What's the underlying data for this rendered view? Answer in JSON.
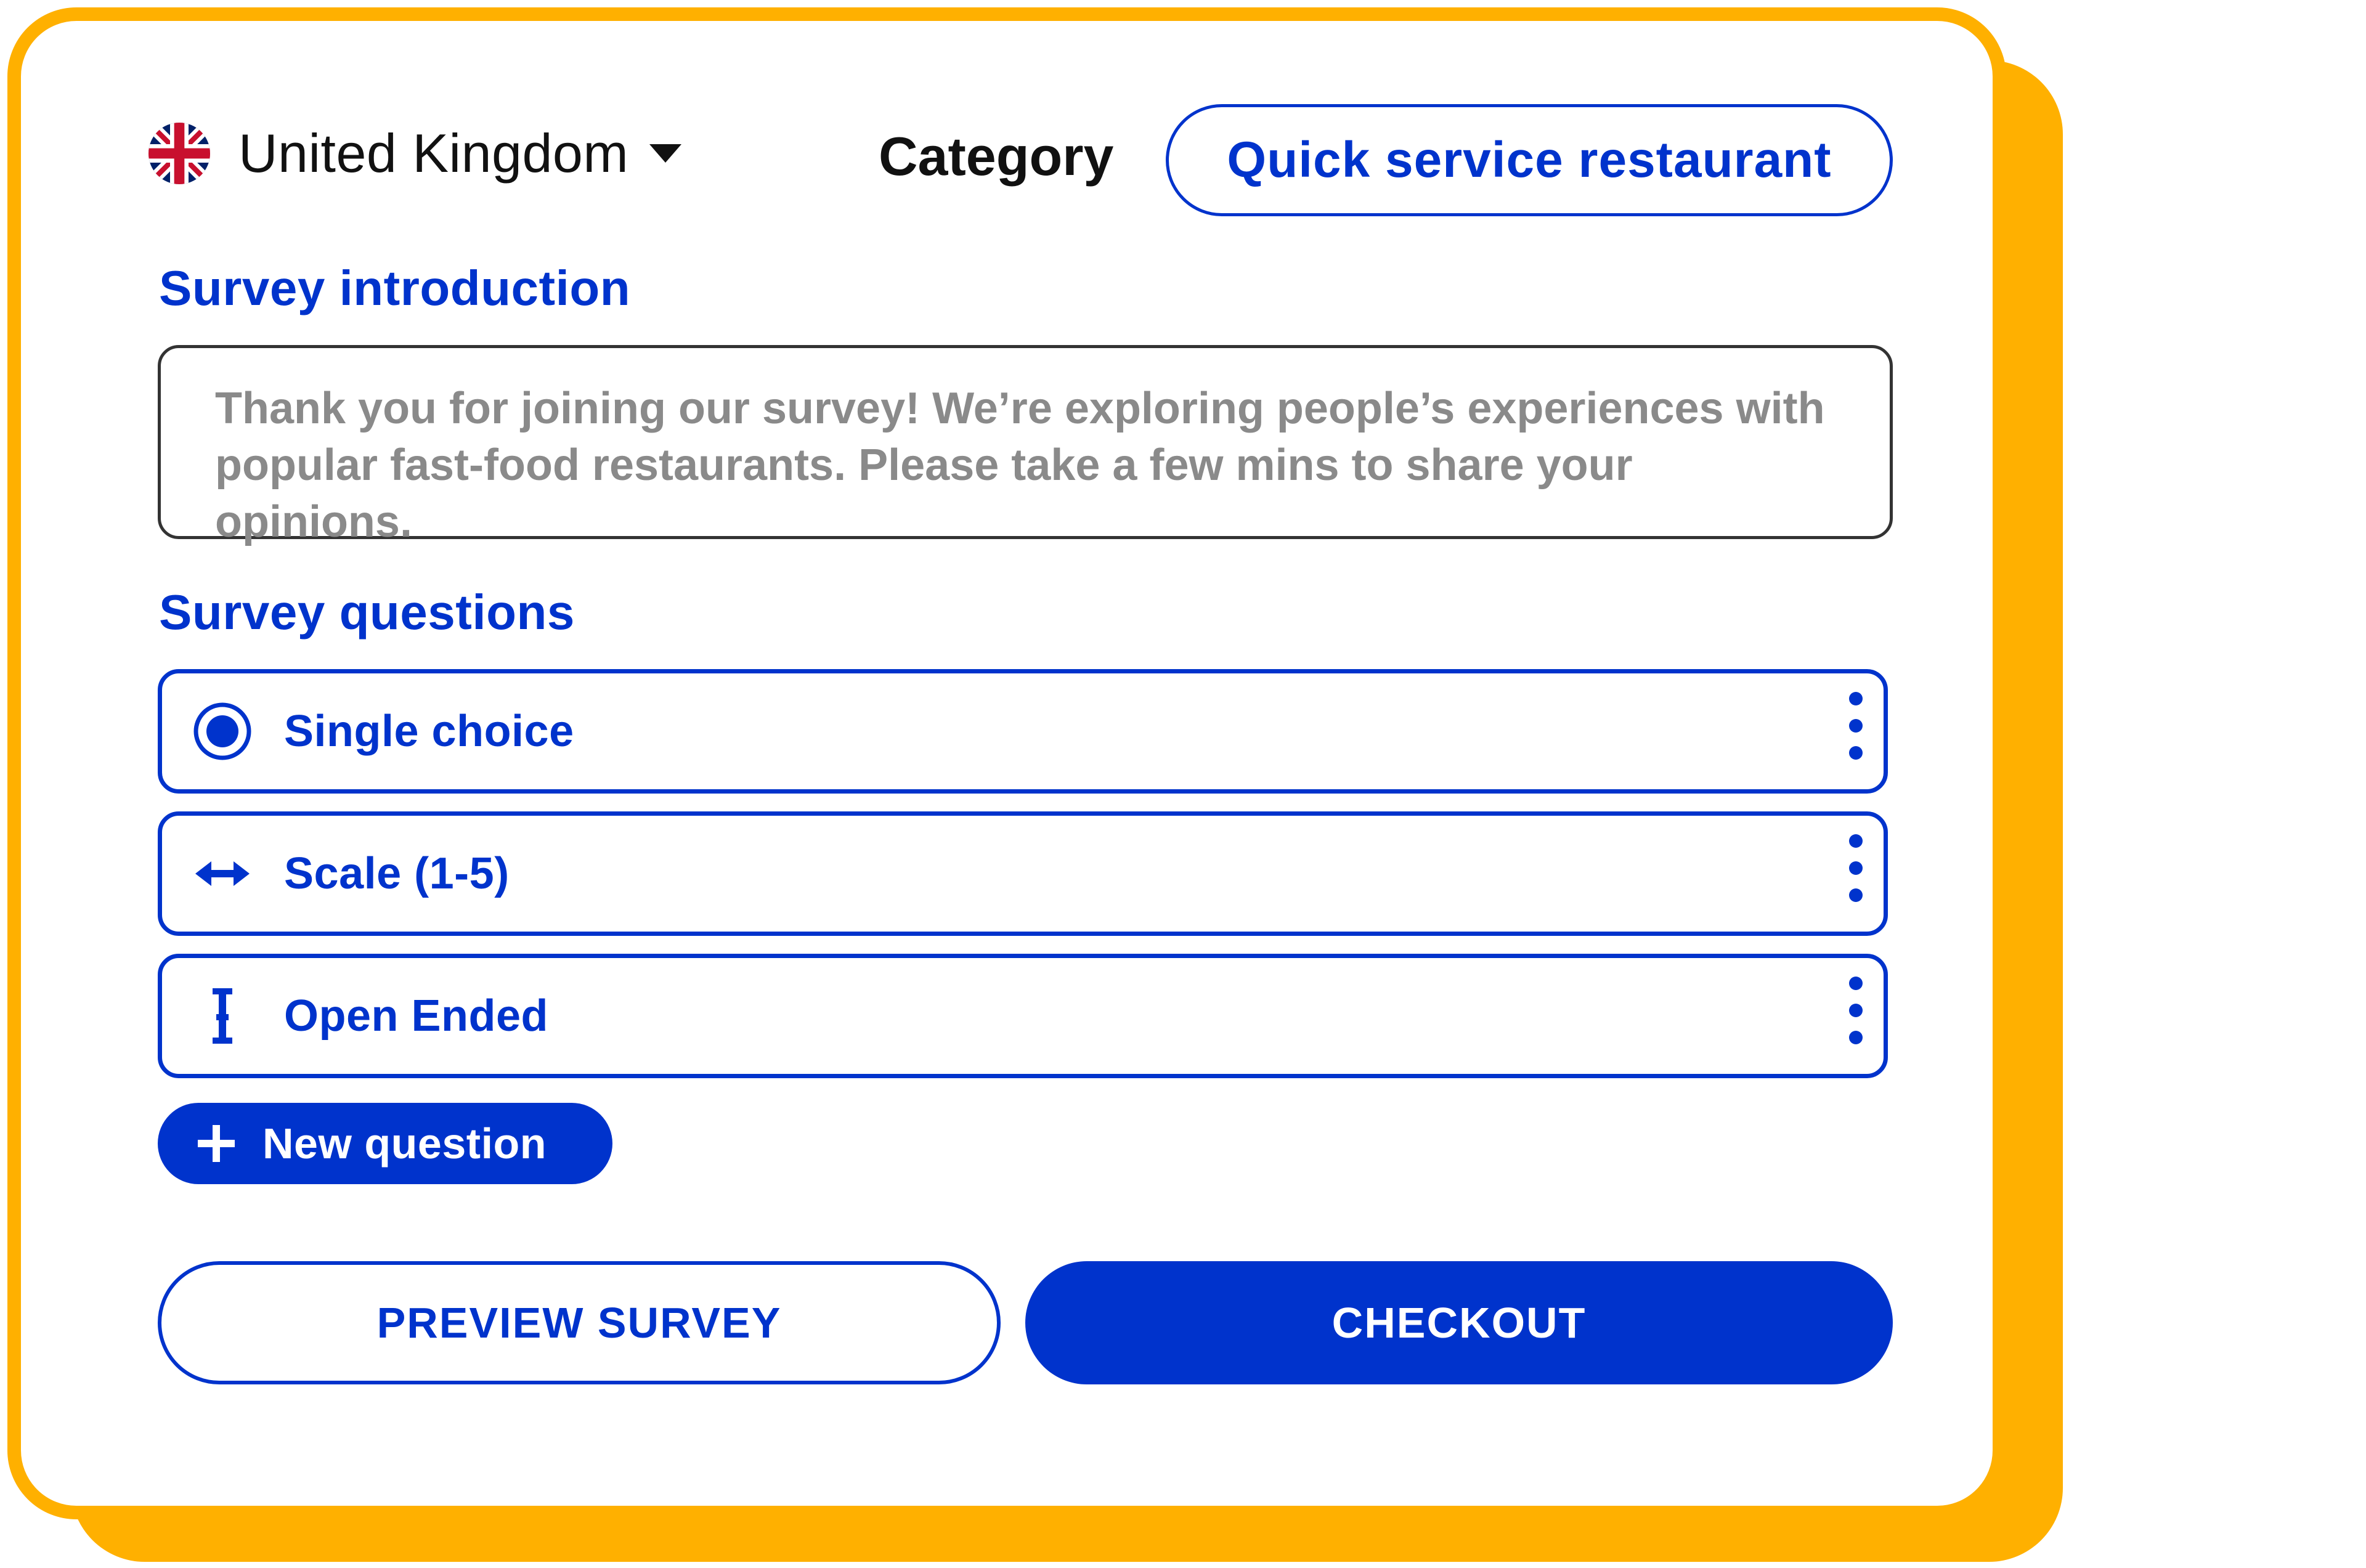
{
  "colors": {
    "accent": "#0033CC",
    "frame": "#FFB000",
    "text_dark": "#111111",
    "placeholder_gray": "#8a8a8a"
  },
  "header": {
    "country": {
      "label": "United Kingdom",
      "flag_icon": "uk-flag-icon",
      "dropdown_icon": "caret-down-icon"
    },
    "category_label": "Category",
    "category_value": "Quick service restaurant"
  },
  "intro": {
    "title": "Survey introduction",
    "text": "Thank you for joining our survey!  We’re exploring people’s experiences with popular fast-food restaurants. Please take a few mins to share your opinions."
  },
  "questions": {
    "title": "Survey questions",
    "items": [
      {
        "label": "Single choice",
        "icon": "radio-selected-icon",
        "menu_icon": "kebab-menu-icon"
      },
      {
        "label": "Scale (1-5)",
        "icon": "horizontal-arrows-icon",
        "menu_icon": "kebab-menu-icon"
      },
      {
        "label": "Open Ended",
        "icon": "text-cursor-icon",
        "menu_icon": "kebab-menu-icon"
      }
    ],
    "new_question_label": "New question",
    "new_question_icon": "plus-icon"
  },
  "actions": {
    "preview_label": "PREVIEW SURVEY",
    "checkout_label": "CHECKOUT"
  }
}
